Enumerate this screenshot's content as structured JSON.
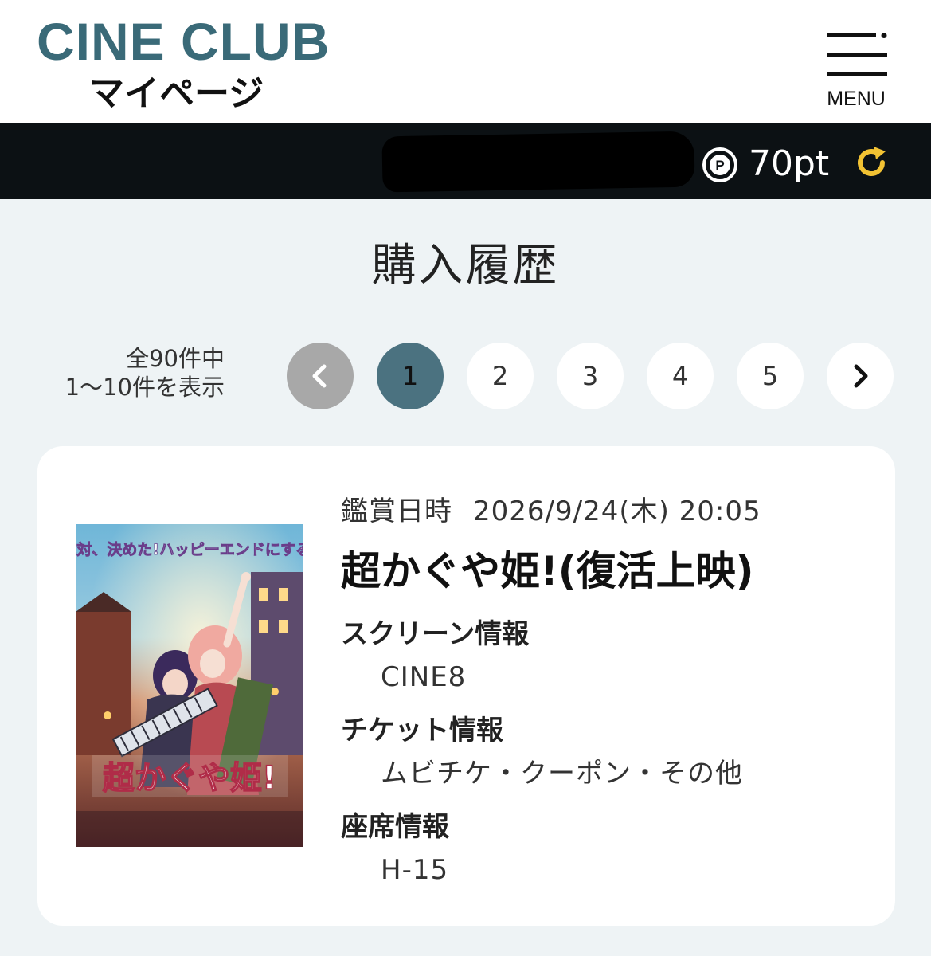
{
  "header": {
    "logo": "CINE CLUB",
    "subtitle": "マイページ",
    "menu_label": "MENU"
  },
  "user_bar": {
    "points": "70pt",
    "points_icon": "points-p-icon",
    "refresh_icon": "refresh-icon"
  },
  "page_title": "購入履歴",
  "pagination": {
    "total_line": "全90件中",
    "range_line": "1〜10件を表示",
    "pages": [
      "1",
      "2",
      "3",
      "4",
      "5"
    ],
    "active_page": "1"
  },
  "purchase": {
    "datetime_label": "鑑賞日時",
    "datetime_value": "2026/9/24(木) 20:05",
    "title": "超かぐや姫!(復活上映)",
    "screen_label": "スクリーン情報",
    "screen_value": "CINE8",
    "ticket_label": "チケット情報",
    "ticket_value": "ムビチケ・クーポン・その他",
    "seat_label": "座席情報",
    "seat_value": "H-15",
    "poster_title": "超かぐや姫!",
    "poster_tagline": "絶対、決めた!ハッピーエンドにする!"
  },
  "colors": {
    "brand": "#3a6a78",
    "active_page": "#4b7280",
    "points_refresh": "#f2c233",
    "bar": "#0c1114",
    "background": "#eef3f5"
  }
}
